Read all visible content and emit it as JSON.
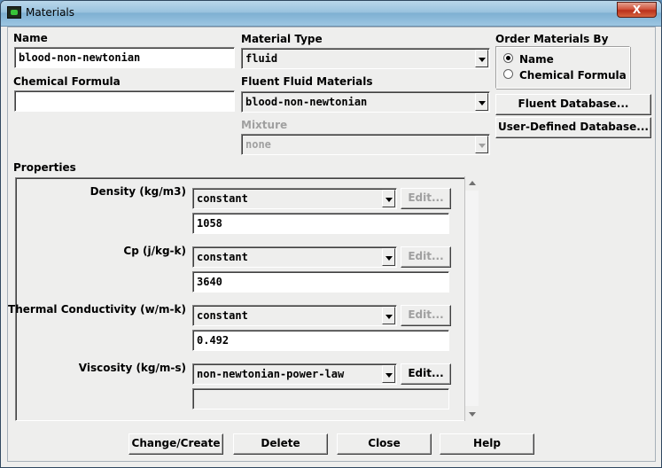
{
  "window": {
    "title": "Materials",
    "close_glyph": "X"
  },
  "name": {
    "label": "Name",
    "value": "blood-non-newtonian"
  },
  "chemical_formula": {
    "label": "Chemical Formula",
    "value": ""
  },
  "material_type": {
    "label": "Material Type",
    "selected": "fluid"
  },
  "fluent_fluid_materials": {
    "label": "Fluent Fluid Materials",
    "selected": "blood-non-newtonian"
  },
  "mixture": {
    "label": "Mixture",
    "selected": "none",
    "disabled": true
  },
  "order_by": {
    "label": "Order Materials By",
    "options": [
      {
        "label": "Name",
        "selected": true
      },
      {
        "label": "Chemical Formula",
        "selected": false
      }
    ]
  },
  "database_buttons": {
    "fluent": "Fluent Database...",
    "user_defined": "User-Defined Database..."
  },
  "properties": {
    "label": "Properties",
    "items": [
      {
        "label": "Density (kg/m3)",
        "method": "constant",
        "value": "1058",
        "edit_label": "Edit...",
        "edit_enabled": false
      },
      {
        "label": "Cp (j/kg-k)",
        "method": "constant",
        "value": "3640",
        "edit_label": "Edit...",
        "edit_enabled": false
      },
      {
        "label": "Thermal Conductivity (w/m-k)",
        "method": "constant",
        "value": "0.492",
        "edit_label": "Edit...",
        "edit_enabled": false
      },
      {
        "label": "Viscosity (kg/m-s)",
        "method": "non-newtonian-power-law",
        "value": "",
        "edit_label": "Edit...",
        "edit_enabled": true
      }
    ]
  },
  "footer": {
    "change_create": "Change/Create",
    "delete": "Delete",
    "close": "Close",
    "help": "Help"
  },
  "colors": {
    "titlebar": "#9ac3de",
    "close_button": "#c7412b",
    "dialog_bg": "#eeeeed",
    "disabled_text": "#a0a0a0"
  }
}
